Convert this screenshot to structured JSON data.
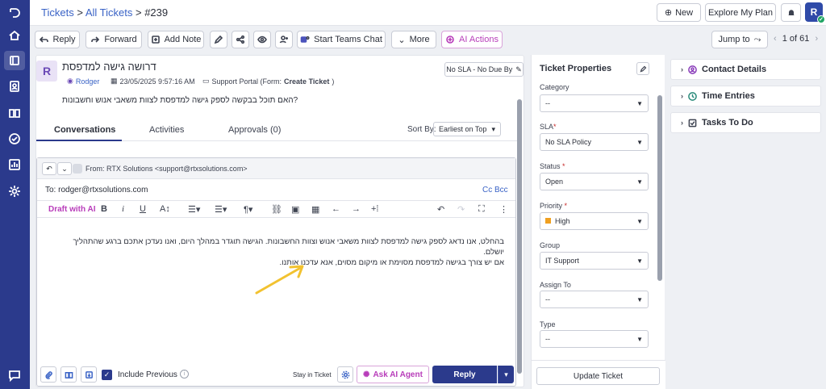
{
  "header": {
    "breadcrumb_root": "Tickets",
    "breadcrumb_sep": ">",
    "breadcrumb_list": "All Tickets",
    "breadcrumb_id": "#239",
    "new_label": "New",
    "explore_label": "Explore My Plan",
    "avatar_initial": "R"
  },
  "toolbar": {
    "reply": "Reply",
    "forward": "Forward",
    "add_note": "Add Note",
    "teams_chat": "Start Teams Chat",
    "more": "More",
    "ai_actions": "AI Actions",
    "jump_to": "Jump to",
    "pager": "1 of 61"
  },
  "ticket": {
    "avatar_initial": "R",
    "subject": "דרושה גישה למדפסת",
    "requester": "Rodger",
    "date": "23/05/2025 9:57:16 AM",
    "source_prefix": "Support Portal (Form: ",
    "source_form": "Create Ticket",
    "source_suffix": ")",
    "sla_label": "No SLA - No Due By",
    "description": "האם תוכל בבקשה לספק גישה למדפסת לצוות משאבי אנוש וחשבונות?"
  },
  "tabs": {
    "conversations": "Conversations",
    "activities": "Activities",
    "approvals": "Approvals (0)",
    "sort_label": "Sort By:",
    "sort_value": "Earliest on Top"
  },
  "editor": {
    "from_label": "From:",
    "from_value": "RTX Solutions <support@rtxsolutions.com>",
    "to_label": "To:",
    "to_value": "rodger@rtxsolutions.com",
    "cc": "Cc",
    "bcc": "Bcc",
    "draft_ai": "Draft with AI",
    "body_line1": "בהחלט, אנו נדאג לספק גישה למדפסת לצוות משאבי אנוש וצוות החשבונות. הגישה תוגדר במהלך היום, ואנו נעדכן אתכם ברגע שהתהליך יושלם.",
    "body_line2": "אם יש צורך בגישה למדפסת מסוימת או מיקום מסוים, אנא עדכנו אותנו.",
    "include_previous": "Include Previous",
    "stay_in_ticket": "Stay in Ticket",
    "ask_ai": "Ask AI Agent",
    "reply": "Reply"
  },
  "properties": {
    "title": "Ticket Properties",
    "fields": [
      {
        "label": "Category",
        "required": false,
        "value": "--"
      },
      {
        "label": "SLA",
        "required": true,
        "value": "No SLA Policy"
      },
      {
        "label": "Status",
        "required": true,
        "value": "Open"
      },
      {
        "label": "Priority",
        "required": true,
        "value": "High"
      },
      {
        "label": "Group",
        "required": false,
        "value": "IT Support"
      },
      {
        "label": "Assign To",
        "required": false,
        "value": "--"
      },
      {
        "label": "Type",
        "required": false,
        "value": "--"
      }
    ],
    "update_label": "Update Ticket",
    "priority_color": "#f0a020"
  },
  "side_cards": {
    "contact": "Contact Details",
    "time": "Time Entries",
    "todo": "Tasks To Do"
  },
  "colors": {
    "rail": "#2b3a8c",
    "accent": "#3a63c6",
    "ai": "#b83dba"
  }
}
